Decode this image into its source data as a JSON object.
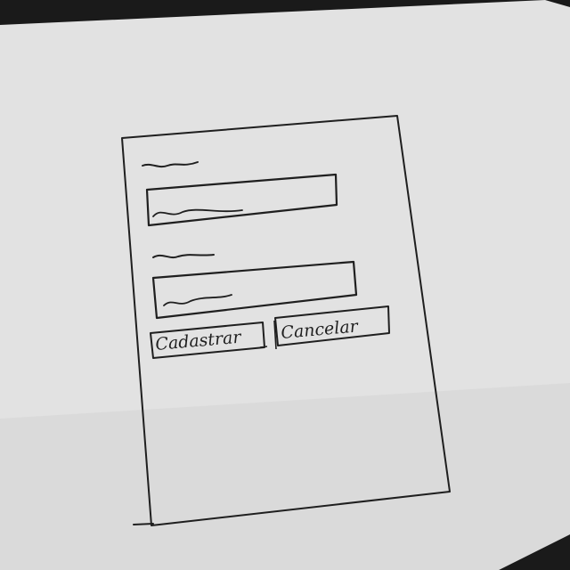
{
  "form": {
    "field_1": {
      "label": "",
      "value": ""
    },
    "field_2": {
      "label": "",
      "value": ""
    },
    "submit_label": "Cadastrar",
    "cancel_label": "Cancelar"
  }
}
